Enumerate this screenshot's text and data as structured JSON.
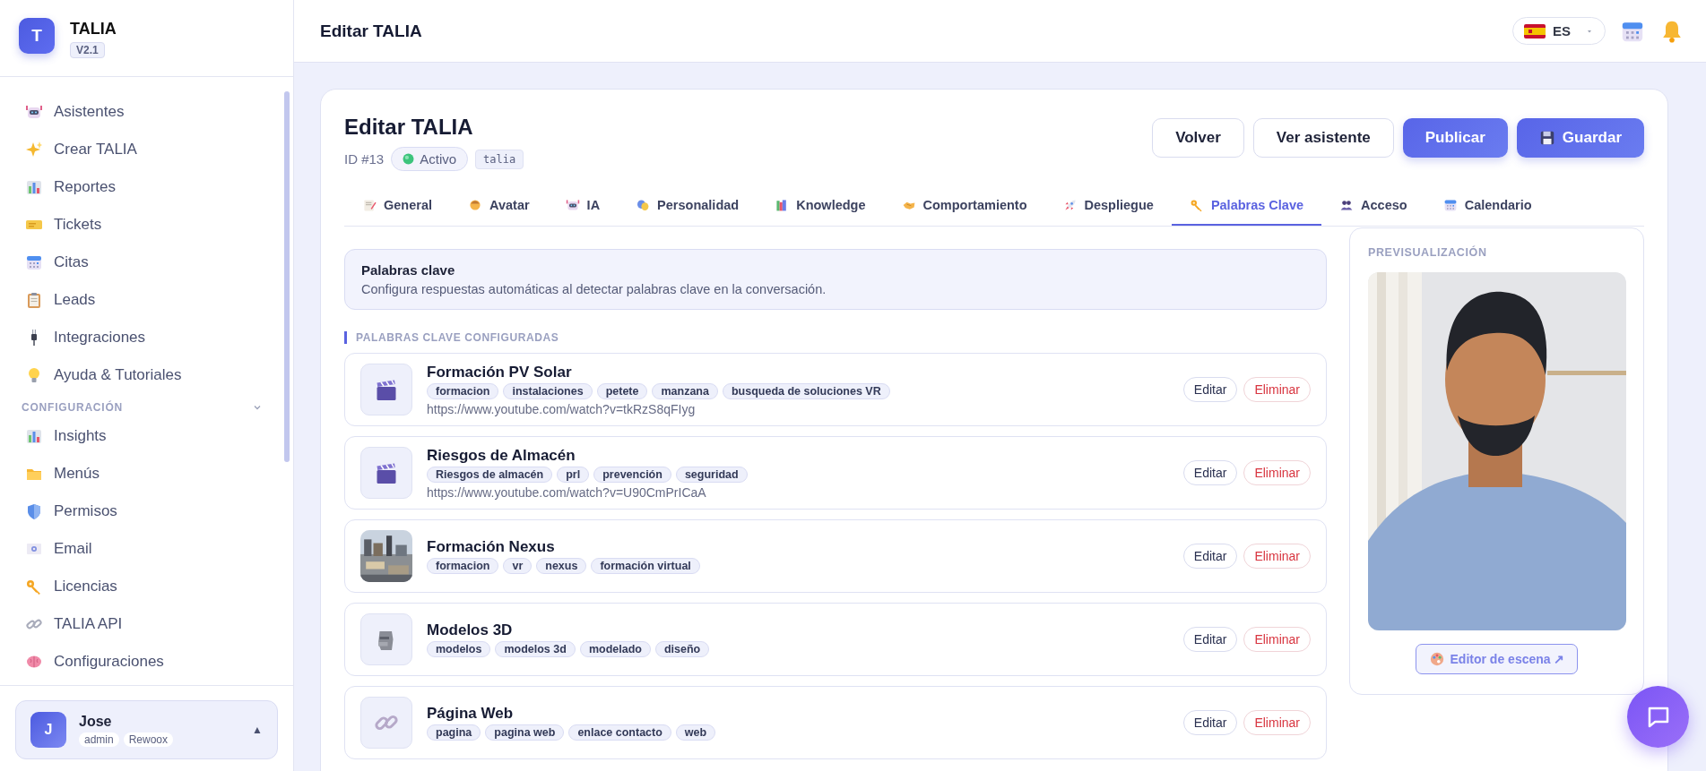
{
  "sidebar": {
    "brand": {
      "logo_letter": "T",
      "name": "TALIA",
      "version": "V2.1"
    },
    "items": [
      {
        "label": "Asistentes"
      },
      {
        "label": "Crear TALIA"
      },
      {
        "label": "Reportes"
      },
      {
        "label": "Tickets"
      },
      {
        "label": "Citas"
      },
      {
        "label": "Leads"
      },
      {
        "label": "Integraciones"
      },
      {
        "label": "Ayuda & Tutoriales"
      }
    ],
    "section": {
      "label": "CONFIGURACIÓN",
      "expanded": true,
      "items": [
        {
          "label": "Insights"
        },
        {
          "label": "Menús"
        },
        {
          "label": "Permisos"
        },
        {
          "label": "Email"
        },
        {
          "label": "Licencias"
        },
        {
          "label": "TALIA API"
        },
        {
          "label": "Configuraciones"
        }
      ]
    },
    "user": {
      "avatar_letter": "J",
      "name": "Jose",
      "tags": [
        "admin",
        "Rewoox"
      ],
      "menu_caret": "▲"
    }
  },
  "header": {
    "title": "Editar TALIA",
    "language": "ES"
  },
  "editor": {
    "title": "Editar TALIA",
    "id": "ID #13",
    "status": "Activo",
    "slug": "talia",
    "buttons": [
      {
        "label": "Volver",
        "kind": "outline"
      },
      {
        "label": "Ver asistente",
        "kind": "outline"
      },
      {
        "label": "Publicar",
        "kind": "primary"
      },
      {
        "label": "Guardar",
        "kind": "save"
      }
    ],
    "tabs": [
      {
        "label": "General",
        "selected": false
      },
      {
        "label": "Avatar",
        "selected": false
      },
      {
        "label": "IA",
        "selected": false
      },
      {
        "label": "Personalidad",
        "selected": false
      },
      {
        "label": "Knowledge",
        "selected": false
      },
      {
        "label": "Comportamiento",
        "selected": false
      },
      {
        "label": "Despliegue",
        "selected": false
      },
      {
        "label": "Palabras Clave",
        "selected": true
      },
      {
        "label": "Acceso",
        "selected": false
      },
      {
        "label": "Calendario",
        "selected": false
      }
    ],
    "info": {
      "title": "Palabras clave",
      "text": "Configura respuestas automáticas al detectar palabras clave en la conversación."
    },
    "section_label": "PALABRAS CLAVE CONFIGURADAS",
    "keywords": [
      {
        "kind": "video",
        "title": "Formación PV Solar",
        "tags": [
          "formacion",
          "instalaciones",
          "petete",
          "manzana",
          "busqueda de soluciones VR"
        ],
        "url": "https://www.youtube.com/watch?v=tkRzS8qFIyg",
        "actions": [
          "Editar",
          "Eliminar"
        ]
      },
      {
        "kind": "video",
        "title": "Riesgos de Almacén",
        "tags": [
          "Riesgos de almacén",
          "prl",
          "prevención",
          "seguridad"
        ],
        "url": "https://www.youtube.com/watch?v=U90CmPrICaA",
        "actions": [
          "Editar",
          "Eliminar"
        ]
      },
      {
        "title": "Formación Nexus",
        "tags": [
          "formacion",
          "vr",
          "nexus",
          "formación virtual"
        ],
        "actions": [
          "Editar",
          "Eliminar"
        ]
      },
      {
        "kind": "model",
        "title": "Modelos 3D",
        "tags": [
          "modelos",
          "modelos 3d",
          "modelado",
          "diseño"
        ],
        "actions": [
          "Editar",
          "Eliminar"
        ]
      },
      {
        "kind": "link",
        "title": "Página Web",
        "tags": [
          "pagina",
          "pagina web",
          "enlace contacto",
          "web"
        ],
        "actions": [
          "Editar",
          "Eliminar"
        ]
      }
    ],
    "preview": {
      "label": "PREVISUALIZACIÓN",
      "button": "Editor de escena ↗"
    }
  }
}
